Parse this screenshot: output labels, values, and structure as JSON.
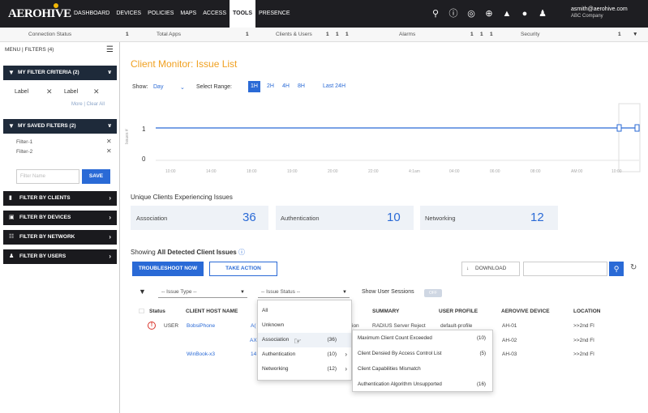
{
  "app": {
    "logo": "AEROHIVE",
    "nav": [
      "DASHBOARD",
      "DEVICES",
      "POLICIES",
      "MAPS",
      "ACCESS",
      "TOOLS",
      "PRESENCE"
    ],
    "active_nav": "TOOLS",
    "icons": [
      "search-icon",
      "help-icon",
      "globe-icon",
      "add-icon",
      "bell-icon",
      "info-icon",
      "user-icon"
    ],
    "user_email": "asmith@aerohive.com",
    "user_company": "ABC Company"
  },
  "statusbar": {
    "items": [
      {
        "label": "Connection Status",
        "count": "1"
      },
      {
        "label": "Total Apps",
        "count": "1"
      },
      {
        "label": "Clients & Users",
        "counts": [
          "1",
          "1",
          "1"
        ]
      },
      {
        "label": "Alarms",
        "counts": [
          "1",
          "1",
          "1"
        ]
      },
      {
        "label": "Security",
        "count": "1"
      }
    ]
  },
  "sidebar": {
    "menu_label": "MENU | FILTERS (4)",
    "criteria_title": "MY FILTER CRITERIA (2)",
    "chips": [
      "Label",
      "Label"
    ],
    "more_clear": "More | Clear All",
    "saved_title": "MY SAVED FILTERS (2)",
    "saved": [
      "Filter-1",
      "Filter-2"
    ],
    "filter_placeholder": "Filter Name",
    "save_label": "SAVE",
    "items": [
      "FILTER BY CLIENTS",
      "FILTER BY DEVICES",
      "FILTER BY NETWORK",
      "FILTER BY USERS"
    ]
  },
  "main": {
    "title": "Client Monitor: Issue List",
    "show_label": "Show:",
    "show_value": "Day",
    "range_label": "Select Range:",
    "ranges": [
      "1H",
      "2H",
      "4H",
      "8H",
      "Last 24H"
    ],
    "active_range": "1H",
    "unique_title": "Unique Clients Experiencing Issues",
    "counts": [
      {
        "label": "Association",
        "value": "36"
      },
      {
        "label": "Authentication",
        "value": "10"
      },
      {
        "label": "Networking",
        "value": "12"
      }
    ],
    "showing_prefix": "Showing",
    "showing_bold": "All Detected Client Issues",
    "troubleshoot_label": "TROUBLESHOOT NOW",
    "take_action_label": "TAKE ACTION",
    "download_label": "DOWNLOAD",
    "issue_type": "-- Issue Type --",
    "issue_status": "-- Issue Status --",
    "show_sessions": "Show User Sessions",
    "toggle": "OFF"
  },
  "table": {
    "headers": [
      "Status",
      "CLIENT HOST NAME",
      "SUMMARY",
      "USER PROFILE",
      "AEROVIVE DEVICE",
      "LOCATION"
    ],
    "rows": [
      {
        "status": "USER",
        "host": "BobsiPhone",
        "col3": "A(",
        "col4": "ion",
        "summary": "RADIUS Server Reject",
        "profile": "default-profile",
        "device": "AH-01",
        "location": ">>2nd Fl"
      },
      {
        "status": "",
        "host": "",
        "col3": "AX",
        "col4": "",
        "summary": "",
        "profile": "",
        "device": "AH-02",
        "location": ">>2nd Fl"
      },
      {
        "status": "",
        "host": "WinBook-x3",
        "col3": "14",
        "col4": "",
        "summary": "",
        "profile": "",
        "device": "AH-03",
        "location": ">>2nd Fl"
      }
    ]
  },
  "dropdown": {
    "items": [
      {
        "label": "All",
        "count": ""
      },
      {
        "label": "Unknown",
        "count": ""
      },
      {
        "label": "Association",
        "count": "(36)"
      },
      {
        "label": "Authentication",
        "count": "(10)"
      },
      {
        "label": "Networking",
        "count": "(12)"
      }
    ]
  },
  "submenu": {
    "items": [
      {
        "label": "Maximum Client Count Exceeded",
        "count": "(10)"
      },
      {
        "label": "Client Densied By Access Control List",
        "count": "(5)"
      },
      {
        "label": "Client Capabilities Mismatch",
        "count": ""
      },
      {
        "label": "Authentication Algorithm Unsupported",
        "count": "(16)"
      }
    ]
  },
  "chart_data": {
    "type": "line",
    "ylabel": "Issues #",
    "yticks": [
      "1",
      "0"
    ],
    "xticks": [
      "10:00",
      "14:00",
      "18:00",
      "19:00",
      "20:00",
      "22:00",
      "4:1am",
      "04:00",
      "06:00",
      "08:00",
      "AM:00",
      "10:00"
    ],
    "series": [
      {
        "values": [
          1,
          1,
          1,
          1,
          1,
          1,
          1,
          1,
          1,
          1,
          1,
          1
        ]
      }
    ],
    "colors": {
      "line": "#2a6ad6",
      "accent": "#f0a020"
    }
  }
}
